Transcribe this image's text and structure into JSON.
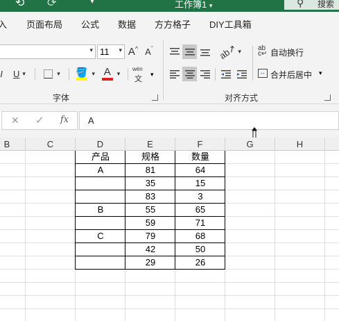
{
  "title": {
    "workbook": "工作簿1",
    "search": "搜索"
  },
  "menu": [
    "入",
    "页面布局",
    "公式",
    "数据",
    "方方格子",
    "DIY工具箱"
  ],
  "ribbon": {
    "font_size": "11",
    "grow_font": "A",
    "shrink_font": "A",
    "italic": "I",
    "underline": "U",
    "font_color": "A",
    "phonetic": "wén",
    "phonetic_char": "文",
    "font_group_label": "字体",
    "wrap_text": "自动换行",
    "merge_center": "合并后居中",
    "align_group_label": "对齐方式"
  },
  "formula": {
    "cancel": "✕",
    "enter": "✓",
    "fx": "fx",
    "content": "A"
  },
  "columns": [
    "B",
    "C",
    "D",
    "E",
    "F",
    "G",
    "H"
  ],
  "table": {
    "headers": [
      "产品",
      "规格",
      "数量"
    ],
    "rows": [
      [
        "A",
        "81",
        "64"
      ],
      [
        "",
        "35",
        "15"
      ],
      [
        "",
        "83",
        "3"
      ],
      [
        "B",
        "55",
        "65"
      ],
      [
        "",
        "59",
        "71"
      ],
      [
        "C",
        "79",
        "68"
      ],
      [
        "",
        "42",
        "50"
      ],
      [
        "",
        "29",
        "26"
      ]
    ]
  },
  "colors": {
    "title_green": "#217346",
    "highlight_yellow": "#ffff00",
    "font_red": "#e02020"
  }
}
